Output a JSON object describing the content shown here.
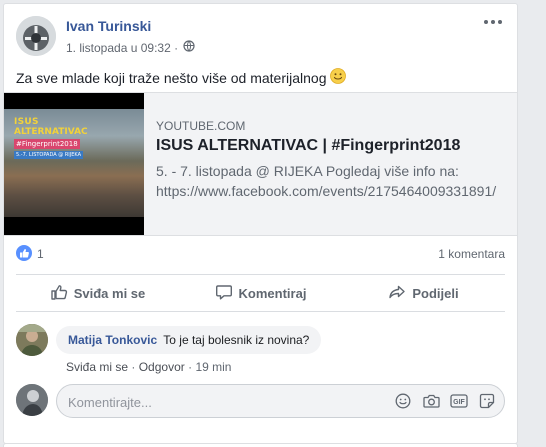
{
  "post": {
    "author": "Ivan Turinski",
    "timestamp": "1. listopada u 09:32 ·",
    "privacy_icon": "globe-icon",
    "text": "Za sve mlade koji traže nešto više od materijalnog",
    "emoji_icon": "smile-emoji-icon"
  },
  "link_preview": {
    "domain": "YOUTUBE.COM",
    "title": "ISUS ALTERNATIVAC | #Fingerprint2018",
    "description": "5. - 7. listopada @ RIJEKA Pogledaj više info na: https://www.facebook.com/events/2175464009331891/",
    "thumbnail": {
      "line1": "ISUS",
      "line2": "ALTERNATIVAC",
      "line3": "#Fingerprint2018",
      "line4": "5.-7. LISTOPADA @ RIJEKA"
    }
  },
  "stats": {
    "likes": "1",
    "comments": "1 komentara"
  },
  "actions": {
    "like": "Sviđa mi se",
    "comment": "Komentiraj",
    "share": "Podijeli"
  },
  "comment": {
    "author": "Matija Tonkovic",
    "text": "To je taj bolesnik iz novina?",
    "like_label": "Sviđa mi se",
    "separator": "·",
    "reply_label": "Odgovor",
    "time": "19 min"
  },
  "reply_box": {
    "placeholder": "Komentirajte..."
  },
  "colors": {
    "link_blue": "#385898",
    "like_badge": "#5890ff",
    "text_gray": "#606770"
  }
}
